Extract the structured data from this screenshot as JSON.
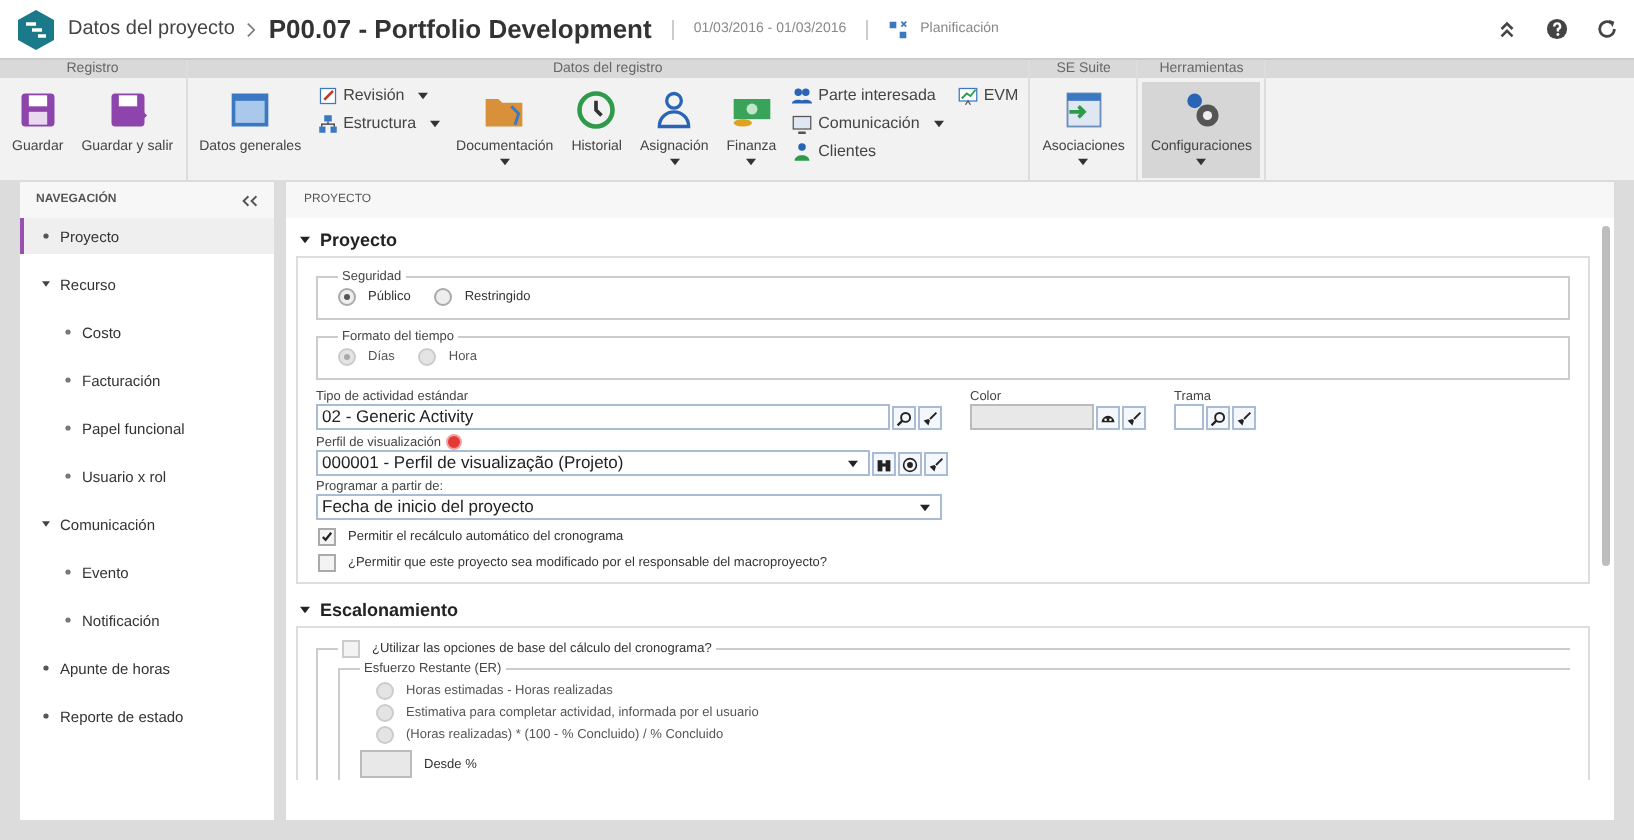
{
  "header": {
    "breadcrumb": "Datos del proyecto",
    "title": "P00.07 - Portfolio Development",
    "dates": "01/03/2016 - 01/03/2016",
    "planning": "Planificación"
  },
  "ribbon": {
    "groups": [
      {
        "title": "Registro",
        "items": [
          {
            "kind": "large",
            "label": "Guardar",
            "dropdown": false,
            "selected": false
          },
          {
            "kind": "large",
            "label": "Guardar y salir",
            "dropdown": false,
            "selected": false
          }
        ]
      },
      {
        "title": "Datos del registro",
        "items": [
          {
            "kind": "large",
            "label": "Datos generales",
            "dropdown": false,
            "selected": false
          },
          {
            "kind": "stack",
            "entries": [
              {
                "label": "Revisión",
                "dropdown": true
              },
              {
                "label": "Estructura",
                "dropdown": true
              }
            ]
          },
          {
            "kind": "large",
            "label": "Documentación",
            "dropdown": true,
            "selected": false
          },
          {
            "kind": "large",
            "label": "Historial",
            "dropdown": false,
            "selected": false
          },
          {
            "kind": "large",
            "label": "Asignación",
            "dropdown": true,
            "selected": false
          },
          {
            "kind": "large",
            "label": "Finanza",
            "dropdown": true,
            "selected": false
          },
          {
            "kind": "stack",
            "entries": [
              {
                "label": "Parte interesada",
                "dropdown": false
              },
              {
                "label": "Comunicación",
                "dropdown": true
              },
              {
                "label": "Clientes",
                "dropdown": false
              }
            ]
          },
          {
            "kind": "stack",
            "entries": [
              {
                "label": "EVM",
                "dropdown": false
              }
            ]
          }
        ]
      },
      {
        "title": "SE Suite",
        "items": [
          {
            "kind": "large",
            "label": "Asociaciones",
            "dropdown": true,
            "selected": false
          }
        ]
      },
      {
        "title": "Herramientas",
        "items": [
          {
            "kind": "large",
            "label": "Configuraciones",
            "dropdown": true,
            "selected": true
          }
        ]
      }
    ]
  },
  "sidebar": {
    "title": "NAVEGACIÓN",
    "items": [
      {
        "label": "Proyecto",
        "selected": true,
        "expanded": false
      },
      {
        "label": "Recurso",
        "selected": false,
        "expanded": true,
        "children": [
          {
            "label": "Costo",
            "selected": false
          },
          {
            "label": "Facturación",
            "selected": false
          },
          {
            "label": "Papel funcional",
            "selected": false
          },
          {
            "label": "Usuario x rol",
            "selected": false
          }
        ]
      },
      {
        "label": "Comunicación",
        "selected": false,
        "expanded": true,
        "children": [
          {
            "label": "Evento",
            "selected": false
          },
          {
            "label": "Notificación",
            "selected": false
          }
        ]
      },
      {
        "label": "Apunte de horas",
        "selected": false,
        "expanded": false
      },
      {
        "label": "Reporte de estado",
        "selected": false,
        "expanded": false
      }
    ]
  },
  "panel_title": "PROYECTO",
  "project_section": {
    "title": "Proyecto",
    "expanded": true,
    "security": {
      "legend": "Seguridad",
      "disabled": false,
      "options": [
        {
          "label": "Público",
          "selected": true
        },
        {
          "label": "Restringido",
          "selected": false
        }
      ]
    },
    "time_format": {
      "legend": "Formato del tiempo",
      "disabled": true,
      "options": [
        {
          "label": "Días",
          "selected": true
        },
        {
          "label": "Hora",
          "selected": false
        }
      ]
    },
    "activity_type": {
      "label": "Tipo de actividad estándar",
      "value": "02 - Generic Activity"
    },
    "color": {
      "label": "Color"
    },
    "pattern": {
      "label": "Trama"
    },
    "view_profile": {
      "label": "Perfil de visualización",
      "required": true,
      "value": "000001 - Perfil de visualização (Projeto)"
    },
    "schedule_from": {
      "label": "Programar a partir de:",
      "value": "Fecha de inicio del proyecto"
    },
    "checks": [
      {
        "label": "Permitir el recálculo automático del cronograma",
        "checked": true
      },
      {
        "label": "¿Permitir que este proyecto sea modificado por el responsable del macroproyecto?",
        "checked": false
      }
    ]
  },
  "scaling_section": {
    "title": "Escalonamiento",
    "expanded": true,
    "use_base": {
      "label": "¿Utilizar las opciones de base del cálculo del cronograma?",
      "checked": false
    },
    "remaining_effort": {
      "legend": "Esfuerzo Restante (ER)",
      "disabled": true,
      "options": [
        {
          "label": "Horas estimadas - Horas realizadas",
          "selected": false
        },
        {
          "label": "Estimativa para completar actividad, informada por el usuario",
          "selected": false
        },
        {
          "label": "(Horas realizadas) * (100 - % Concluido) / % Concluido",
          "selected": false
        }
      ],
      "from_label": "Desde %"
    }
  }
}
